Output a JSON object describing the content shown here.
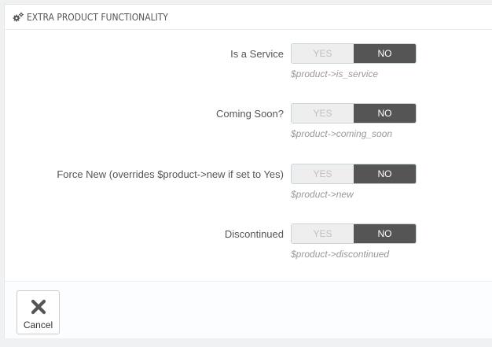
{
  "panel": {
    "title": "EXTRA PRODUCT FUNCTIONALITY",
    "title_icon": "cogs-icon"
  },
  "fields": [
    {
      "label": "Is a Service",
      "yes_label": "YES",
      "no_label": "NO",
      "selected": "NO",
      "help": "$product->is_service"
    },
    {
      "label": "Coming Soon?",
      "yes_label": "YES",
      "no_label": "NO",
      "selected": "NO",
      "help": "$product->coming_soon"
    },
    {
      "label": "Force New (overrides $product->new if set to Yes)",
      "yes_label": "YES",
      "no_label": "NO",
      "selected": "NO",
      "help": "$product->new"
    },
    {
      "label": "Discontinued",
      "yes_label": "YES",
      "no_label": "NO",
      "selected": "NO",
      "help": "$product->discontinued"
    }
  ],
  "footer": {
    "cancel_label": "Cancel",
    "cancel_icon": "close-icon"
  },
  "colors": {
    "switch_active": "#555555",
    "switch_inactive": "#eeeeee",
    "help_text": "#999999"
  }
}
